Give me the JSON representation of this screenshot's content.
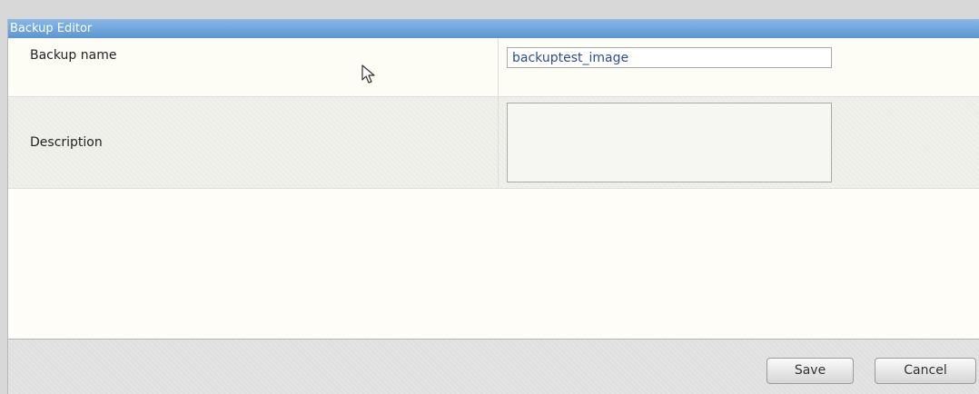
{
  "window": {
    "title": "Backup Editor"
  },
  "form": {
    "backup_name_label": "Backup name",
    "backup_name_value": "backuptest_image",
    "description_label": "Description",
    "description_value": ""
  },
  "footer": {
    "save_label": "Save",
    "cancel_label": "Cancel"
  },
  "colors": {
    "titlebar": "#5a96d2",
    "input_text": "#2a4f8a"
  },
  "icons": {
    "mouse_cursor": "mouse-pointer-icon"
  }
}
